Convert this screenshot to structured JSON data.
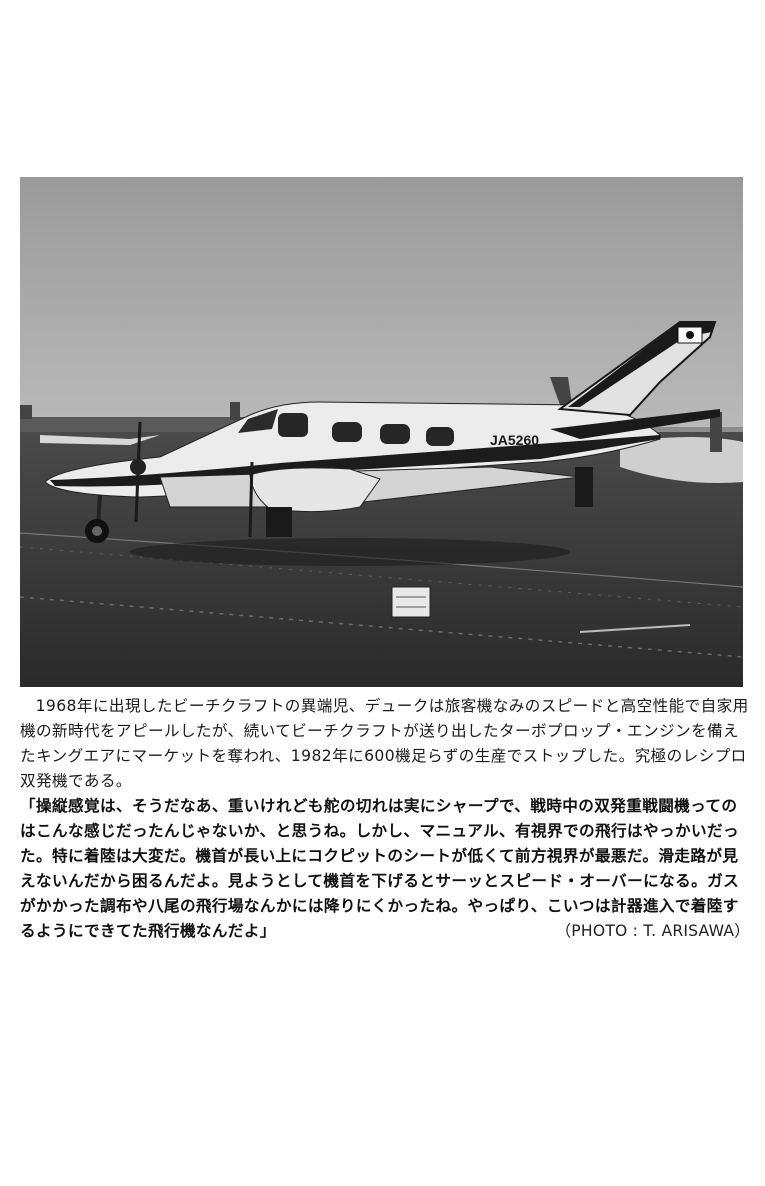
{
  "photo": {
    "registration": "JA5260"
  },
  "caption": "1968年に出現したビーチクラフトの異端児、デュークは旅客機なみのスピードと高空性能で自家用機の新時代をアピールしたが、続いてビーチクラフトが送り出したターボプロップ・エンジンを備えたキングエアにマーケットを奪われ、1982年に600機足らずの生産でストップした。究極のレシプロ双発機である。",
  "quote": "「操縦感覚は、そうだなあ、重いけれども舵の切れは実にシャープで、戦時中の双発重戦闘機ってのはこんな感じだったんじゃないか、と思うね。しかし、マニュアル、有視界での飛行はやっかいだった。特に着陸は大変だ。機首が長い上にコクピットのシートが低くて前方視界が最悪だ。滑走路が見えないんだから困るんだよ。見ようとして機首を下げるとサーッとスピード・オーバーになる。ガスがかかった調布や八尾の飛行場なんかには降りにくかったね。やっぱり、こいつは計器進入で着陸するようにできてた飛行機なんだよ」",
  "credit": "（PHOTO : T. ARISAWA）"
}
